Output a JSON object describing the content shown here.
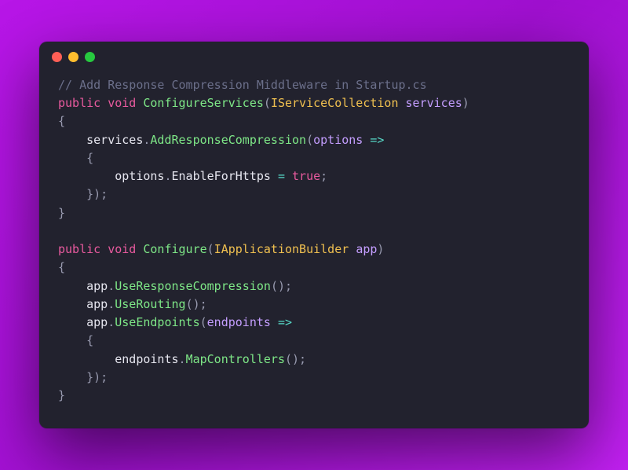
{
  "titlebar": {
    "dot_colors": {
      "close": "#ff5f56",
      "minimize": "#ffbd2e",
      "maximize": "#27c93f"
    }
  },
  "code": {
    "tokens": [
      {
        "c": "comment",
        "t": "// Add Response Compression Middleware in Startup.cs"
      },
      {
        "c": "nl"
      },
      {
        "c": "keyword",
        "t": "public"
      },
      {
        "c": "sp"
      },
      {
        "c": "keyword",
        "t": "void"
      },
      {
        "c": "sp"
      },
      {
        "c": "method",
        "t": "ConfigureServices"
      },
      {
        "c": "punct",
        "t": "("
      },
      {
        "c": "builtin",
        "t": "IServiceCollection"
      },
      {
        "c": "sp"
      },
      {
        "c": "param",
        "t": "services"
      },
      {
        "c": "punct",
        "t": ")"
      },
      {
        "c": "nl"
      },
      {
        "c": "punct",
        "t": "{"
      },
      {
        "c": "nl"
      },
      {
        "c": "indent",
        "t": "    "
      },
      {
        "c": "field",
        "t": "services"
      },
      {
        "c": "punct",
        "t": "."
      },
      {
        "c": "method",
        "t": "AddResponseCompression"
      },
      {
        "c": "punct",
        "t": "("
      },
      {
        "c": "param",
        "t": "options"
      },
      {
        "c": "sp"
      },
      {
        "c": "operator",
        "t": "=>"
      },
      {
        "c": "nl"
      },
      {
        "c": "indent",
        "t": "    "
      },
      {
        "c": "punct",
        "t": "{"
      },
      {
        "c": "nl"
      },
      {
        "c": "indent",
        "t": "        "
      },
      {
        "c": "field",
        "t": "options"
      },
      {
        "c": "punct",
        "t": "."
      },
      {
        "c": "field",
        "t": "EnableForHttps"
      },
      {
        "c": "sp"
      },
      {
        "c": "operator",
        "t": "="
      },
      {
        "c": "sp"
      },
      {
        "c": "literal",
        "t": "true"
      },
      {
        "c": "punct",
        "t": ";"
      },
      {
        "c": "nl"
      },
      {
        "c": "indent",
        "t": "    "
      },
      {
        "c": "punct",
        "t": "});"
      },
      {
        "c": "nl"
      },
      {
        "c": "punct",
        "t": "}"
      },
      {
        "c": "nl"
      },
      {
        "c": "nl"
      },
      {
        "c": "keyword",
        "t": "public"
      },
      {
        "c": "sp"
      },
      {
        "c": "keyword",
        "t": "void"
      },
      {
        "c": "sp"
      },
      {
        "c": "method",
        "t": "Configure"
      },
      {
        "c": "punct",
        "t": "("
      },
      {
        "c": "builtin",
        "t": "IApplicationBuilder"
      },
      {
        "c": "sp"
      },
      {
        "c": "param",
        "t": "app"
      },
      {
        "c": "punct",
        "t": ")"
      },
      {
        "c": "nl"
      },
      {
        "c": "punct",
        "t": "{"
      },
      {
        "c": "nl"
      },
      {
        "c": "indent",
        "t": "    "
      },
      {
        "c": "field",
        "t": "app"
      },
      {
        "c": "punct",
        "t": "."
      },
      {
        "c": "method",
        "t": "UseResponseCompression"
      },
      {
        "c": "punct",
        "t": "();"
      },
      {
        "c": "nl"
      },
      {
        "c": "indent",
        "t": "    "
      },
      {
        "c": "field",
        "t": "app"
      },
      {
        "c": "punct",
        "t": "."
      },
      {
        "c": "method",
        "t": "UseRouting"
      },
      {
        "c": "punct",
        "t": "();"
      },
      {
        "c": "nl"
      },
      {
        "c": "indent",
        "t": "    "
      },
      {
        "c": "field",
        "t": "app"
      },
      {
        "c": "punct",
        "t": "."
      },
      {
        "c": "method",
        "t": "UseEndpoints"
      },
      {
        "c": "punct",
        "t": "("
      },
      {
        "c": "param",
        "t": "endpoints"
      },
      {
        "c": "sp"
      },
      {
        "c": "operator",
        "t": "=>"
      },
      {
        "c": "nl"
      },
      {
        "c": "indent",
        "t": "    "
      },
      {
        "c": "punct",
        "t": "{"
      },
      {
        "c": "nl"
      },
      {
        "c": "indent",
        "t": "        "
      },
      {
        "c": "field",
        "t": "endpoints"
      },
      {
        "c": "punct",
        "t": "."
      },
      {
        "c": "method",
        "t": "MapControllers"
      },
      {
        "c": "punct",
        "t": "();"
      },
      {
        "c": "nl"
      },
      {
        "c": "indent",
        "t": "    "
      },
      {
        "c": "punct",
        "t": "});"
      },
      {
        "c": "nl"
      },
      {
        "c": "punct",
        "t": "}"
      }
    ]
  }
}
